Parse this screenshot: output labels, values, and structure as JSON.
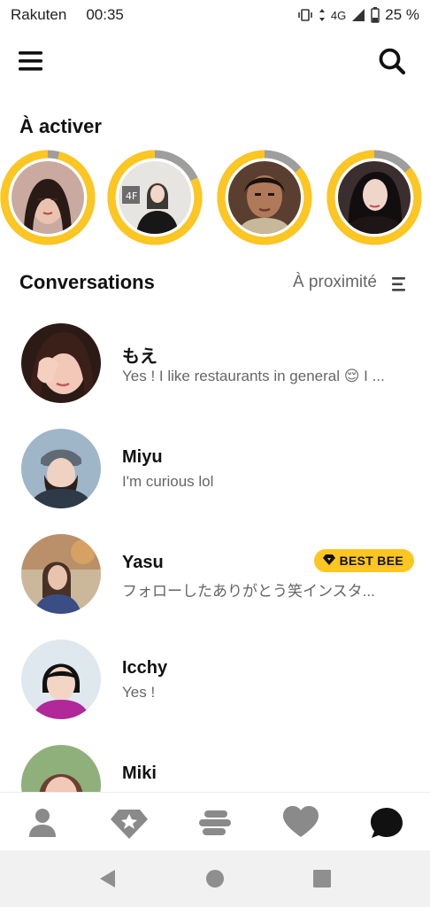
{
  "status_bar": {
    "carrier": "Rakuten",
    "time": "00:35",
    "network": "4G",
    "battery": "25 %"
  },
  "icons": {
    "menu": "menu-icon",
    "search": "search-icon",
    "sort": "sort-icon",
    "profile": "person-icon",
    "discover": "diamond-icon",
    "swipe": "stack-icon",
    "likes": "heart-icon",
    "chat": "chat-bubble-icon"
  },
  "colors": {
    "accent": "#fdc620",
    "ring_track": "#9e9e9e",
    "text_muted": "#666666"
  },
  "to_activate": {
    "title": "À activer",
    "items": [
      {
        "name": "story-1",
        "progress": 0.96
      },
      {
        "name": "story-2",
        "progress": 0.82
      },
      {
        "name": "story-3",
        "progress": 0.86
      },
      {
        "name": "story-4",
        "progress": 0.86
      }
    ]
  },
  "conversations": {
    "title": "Conversations",
    "sort_label": "À proximité",
    "items": [
      {
        "name": "もえ",
        "message": "Yes ! I like restaurants in general 😌 I ..."
      },
      {
        "name": "Miyu",
        "message": "I'm curious lol"
      },
      {
        "name": "Yasu",
        "message": "フォローしたありがとう笑インスタ...",
        "badge": "BEST BEE"
      },
      {
        "name": "Icchy",
        "message": "Yes !"
      },
      {
        "name": "Miki",
        "message": ""
      }
    ]
  }
}
